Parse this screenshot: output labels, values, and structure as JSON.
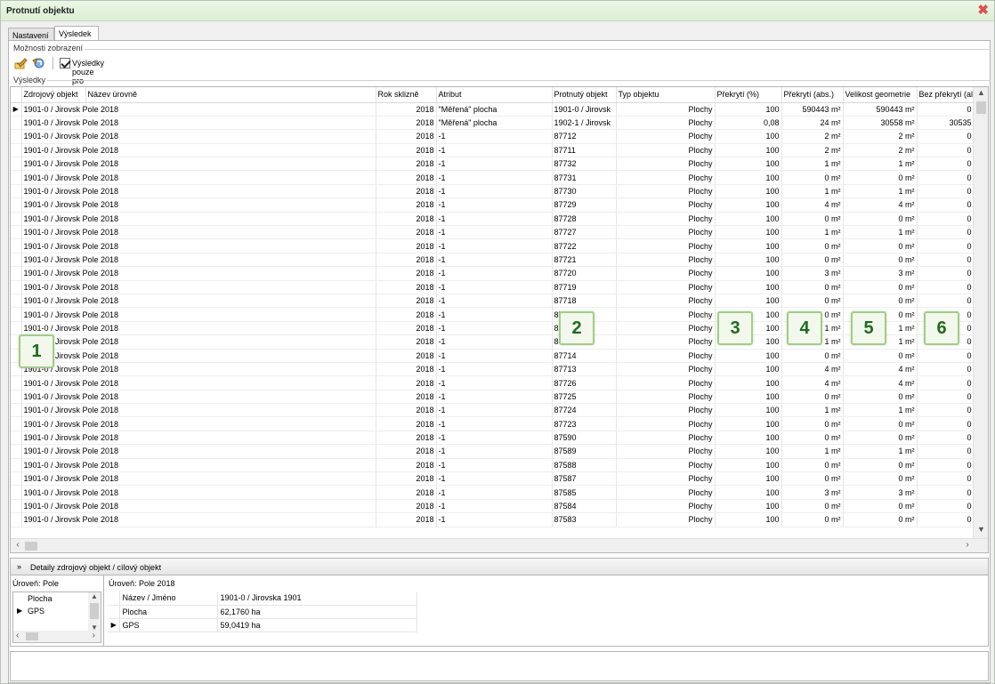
{
  "window": {
    "title": "Protnutí objektu",
    "close_icon": "close-x-icon"
  },
  "tabs": [
    {
      "label": "Nastavení"
    },
    {
      "label": "Výsledek",
      "active": true
    }
  ],
  "options": {
    "group_label": "Možnosti zobrazení",
    "checkbox_label": "Výsledky pouze pro aktuální rok sklizně, datum...",
    "checkbox_checked": true
  },
  "results": {
    "group_label": "Výsledky",
    "columns": [
      "Zdrojový objekt",
      "Název úrovně",
      "Rok sklizně",
      "Atribut",
      "Protnutý objekt",
      "Typ objektu",
      "Překrytí (%)",
      "Překrytí (abs.)",
      "Velikost geometrie",
      "Bez překrytí (al"
    ],
    "rows": [
      [
        "1901-0 / Jirovsk Pole 2018",
        "2018",
        "\"Měřená\" plocha",
        "1901-0 / Jirovsk",
        "Plochy",
        "100",
        "590443 m²",
        "590443 m²",
        "0"
      ],
      [
        "1901-0 / Jirovsk Pole 2018",
        "2018",
        "\"Měřená\" plocha",
        "1902-1 / Jirovsk",
        "Plochy",
        "0,08",
        "24 m²",
        "30558 m²",
        "30535"
      ],
      [
        "1901-0 / Jirovsk Pole 2018",
        "2018",
        "-1",
        "87712",
        "Plochy",
        "100",
        "2 m²",
        "2 m²",
        "0"
      ],
      [
        "1901-0 / Jirovsk Pole 2018",
        "2018",
        "-1",
        "87711",
        "Plochy",
        "100",
        "2 m²",
        "2 m²",
        "0"
      ],
      [
        "1901-0 / Jirovsk Pole 2018",
        "2018",
        "-1",
        "87732",
        "Plochy",
        "100",
        "1 m²",
        "1 m²",
        "0"
      ],
      [
        "1901-0 / Jirovsk Pole 2018",
        "2018",
        "-1",
        "87731",
        "Plochy",
        "100",
        "0 m²",
        "0 m²",
        "0"
      ],
      [
        "1901-0 / Jirovsk Pole 2018",
        "2018",
        "-1",
        "87730",
        "Plochy",
        "100",
        "1 m²",
        "1 m²",
        "0"
      ],
      [
        "1901-0 / Jirovsk Pole 2018",
        "2018",
        "-1",
        "87729",
        "Plochy",
        "100",
        "4 m²",
        "4 m²",
        "0"
      ],
      [
        "1901-0 / Jirovsk Pole 2018",
        "2018",
        "-1",
        "87728",
        "Plochy",
        "100",
        "0 m²",
        "0 m²",
        "0"
      ],
      [
        "1901-0 / Jirovsk Pole 2018",
        "2018",
        "-1",
        "87727",
        "Plochy",
        "100",
        "1 m²",
        "1 m²",
        "0"
      ],
      [
        "1901-0 / Jirovsk Pole 2018",
        "2018",
        "-1",
        "87722",
        "Plochy",
        "100",
        "0 m²",
        "0 m²",
        "0"
      ],
      [
        "1901-0 / Jirovsk Pole 2018",
        "2018",
        "-1",
        "87721",
        "Plochy",
        "100",
        "0 m²",
        "0 m²",
        "0"
      ],
      [
        "1901-0 / Jirovsk Pole 2018",
        "2018",
        "-1",
        "87720",
        "Plochy",
        "100",
        "3 m²",
        "3 m²",
        "0"
      ],
      [
        "1901-0 / Jirovsk Pole 2018",
        "2018",
        "-1",
        "87719",
        "Plochy",
        "100",
        "0 m²",
        "0 m²",
        "0"
      ],
      [
        "1901-0 / Jirovsk Pole 2018",
        "2018",
        "-1",
        "87718",
        "Plochy",
        "100",
        "0 m²",
        "0 m²",
        "0"
      ],
      [
        "1901-0 / Jirovsk Pole 2018",
        "2018",
        "-1",
        "87717",
        "Plochy",
        "100",
        "0 m²",
        "0 m²",
        "0"
      ],
      [
        "1901-0 / Jirovsk Pole 2018",
        "2018",
        "-1",
        "87716",
        "Plochy",
        "100",
        "1 m²",
        "1 m²",
        "0"
      ],
      [
        "1901-0 / Jirovsk Pole 2018",
        "2018",
        "-1",
        "87715",
        "Plochy",
        "100",
        "1 m²",
        "1 m²",
        "0"
      ],
      [
        "1901-0 / Jirovsk Pole 2018",
        "2018",
        "-1",
        "87714",
        "Plochy",
        "100",
        "0 m²",
        "0 m²",
        "0"
      ],
      [
        "1901-0 / Jirovsk Pole 2018",
        "2018",
        "-1",
        "87713",
        "Plochy",
        "100",
        "4 m²",
        "4 m²",
        "0"
      ],
      [
        "1901-0 / Jirovsk Pole 2018",
        "2018",
        "-1",
        "87726",
        "Plochy",
        "100",
        "4 m²",
        "4 m²",
        "0"
      ],
      [
        "1901-0 / Jirovsk Pole 2018",
        "2018",
        "-1",
        "87725",
        "Plochy",
        "100",
        "0 m²",
        "0 m²",
        "0"
      ],
      [
        "1901-0 / Jirovsk Pole 2018",
        "2018",
        "-1",
        "87724",
        "Plochy",
        "100",
        "1 m²",
        "1 m²",
        "0"
      ],
      [
        "1901-0 / Jirovsk Pole 2018",
        "2018",
        "-1",
        "87723",
        "Plochy",
        "100",
        "0 m²",
        "0 m²",
        "0"
      ],
      [
        "1901-0 / Jirovsk Pole 2018",
        "2018",
        "-1",
        "87590",
        "Plochy",
        "100",
        "0 m²",
        "0 m²",
        "0"
      ],
      [
        "1901-0 / Jirovsk Pole 2018",
        "2018",
        "-1",
        "87589",
        "Plochy",
        "100",
        "1 m²",
        "1 m²",
        "0"
      ],
      [
        "1901-0 / Jirovsk Pole 2018",
        "2018",
        "-1",
        "87588",
        "Plochy",
        "100",
        "0 m²",
        "0 m²",
        "0"
      ],
      [
        "1901-0 / Jirovsk Pole 2018",
        "2018",
        "-1",
        "87587",
        "Plochy",
        "100",
        "0 m²",
        "0 m²",
        "0"
      ],
      [
        "1901-0 / Jirovsk Pole 2018",
        "2018",
        "-1",
        "87585",
        "Plochy",
        "100",
        "3 m²",
        "3 m²",
        "0"
      ],
      [
        "1901-0 / Jirovsk Pole 2018",
        "2018",
        "-1",
        "87584",
        "Plochy",
        "100",
        "0 m²",
        "0 m²",
        "0"
      ],
      [
        "1901-0 / Jirovsk Pole 2018",
        "2018",
        "-1",
        "87583",
        "Plochy",
        "100",
        "0 m²",
        "0 m²",
        "0"
      ]
    ],
    "selected_row": 0
  },
  "badges": [
    "1",
    "2",
    "3",
    "4",
    "5",
    "6"
  ],
  "details": {
    "header": "Detaily zdrojový objekt / cílový objekt",
    "left_level": "Úroveň: Pole",
    "left_items": [
      "Plocha",
      "GPS"
    ],
    "right_level": "Úroveň: Pole 2018",
    "attributes": [
      {
        "name": "Název / Jméno",
        "value": "1901-0 / Jirovska 1901"
      },
      {
        "name": "Plocha",
        "value": "62,1760 ha"
      },
      {
        "name": "GPS",
        "value": "59,0419 ha"
      }
    ]
  },
  "colors": {
    "title_bar": "#dcefd4",
    "badge_border": "#9fcf82",
    "badge_text": "#1e6b1e",
    "close": "#e05050"
  }
}
